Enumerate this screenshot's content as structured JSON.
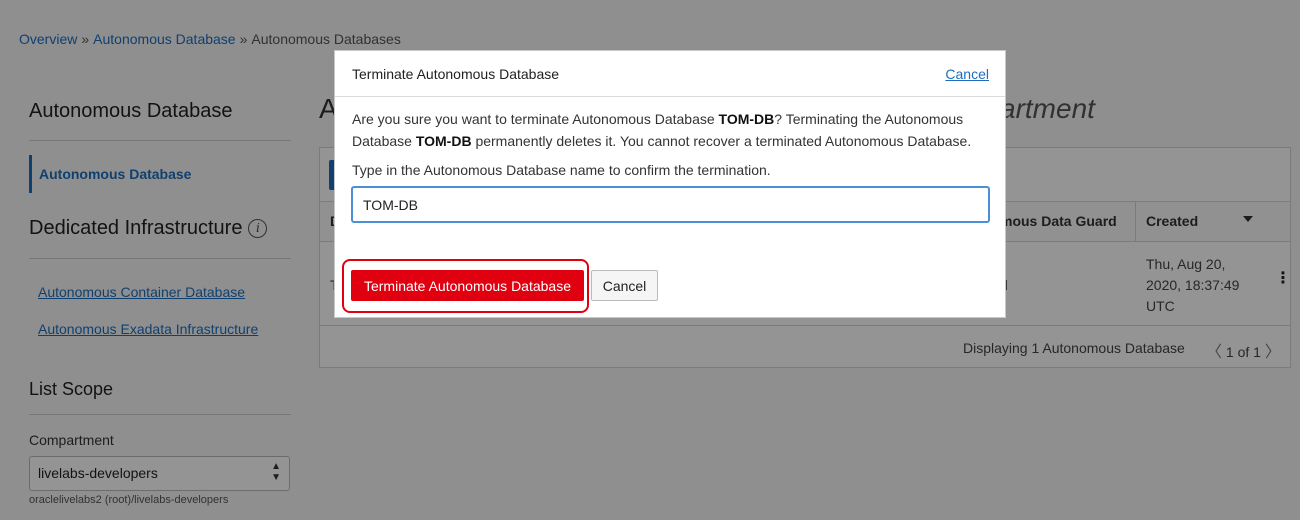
{
  "breadcrumb": {
    "items": [
      "Overview",
      "Autonomous Database",
      "Autonomous Databases"
    ],
    "separator": "»"
  },
  "sidebar": {
    "section1_title": "Autonomous Database",
    "active_item": "Autonomous Database",
    "section2_title": "Dedicated Infrastructure",
    "info_icon": "i",
    "links": [
      "Autonomous Container Database",
      "Autonomous Exadata Infrastructure"
    ],
    "scope_title": "List Scope",
    "compartment_label": "Compartment",
    "compartment_value": "livelabs-developers",
    "compartment_path": "oraclelivelabs2 (root)/livelabs-developers"
  },
  "main": {
    "title_left": "A",
    "title_right": "artment",
    "table": {
      "header_partial_left": "D",
      "header_data_guard": "mous Data Guard",
      "header_created": "Created",
      "row_partial_left": "T",
      "row_partial": "d",
      "created_value": "Thu, Aug 20, 2020, 18:37:49 UTC",
      "kebab": "⋮"
    },
    "pager": {
      "text": "Displaying 1 Autonomous Database",
      "page": "1 of 1",
      "prev": "〈",
      "next": "〉"
    }
  },
  "modal": {
    "title": "Terminate Autonomous Database",
    "cancel_link": "Cancel",
    "body_part1": "Are you sure you want to terminate Autonomous Database ",
    "db_name": "TOM-DB",
    "body_part2": "? Terminating the Autonomous Database ",
    "body_part3": " permanently deletes it. You cannot recover a terminated Autonomous Database.",
    "confirm_label": "Type in the Autonomous Database name to confirm the termination.",
    "input_value": "TOM-DB",
    "terminate_button": "Terminate Autonomous Database",
    "cancel_button": "Cancel"
  },
  "colors": {
    "accent": "#1d6ec0",
    "danger": "#e0000f"
  }
}
